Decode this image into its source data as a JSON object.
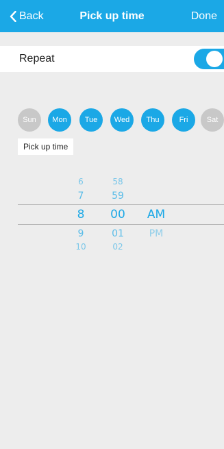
{
  "navbar": {
    "back_label": "Back",
    "title": "Pick up time",
    "done_label": "Done"
  },
  "repeat": {
    "label": "Repeat",
    "enabled": true
  },
  "days": [
    {
      "label": "Sun",
      "selected": false
    },
    {
      "label": "Mon",
      "selected": true
    },
    {
      "label": "Tue",
      "selected": true
    },
    {
      "label": "Wed",
      "selected": true
    },
    {
      "label": "Thu",
      "selected": true
    },
    {
      "label": "Fri",
      "selected": true
    },
    {
      "label": "Sat",
      "selected": false
    }
  ],
  "pickup": {
    "label": "Pick up time"
  },
  "picker": {
    "hours": [
      "6",
      "7",
      "8",
      "9",
      "10"
    ],
    "minutes": [
      "58",
      "59",
      "00",
      "01",
      "02"
    ],
    "ampm": [
      "AM",
      "PM"
    ],
    "selected": {
      "hour": "8",
      "minute": "00",
      "ampm": "AM"
    }
  },
  "colors": {
    "accent": "#1ba8e6",
    "day_off": "#c8c8c8",
    "background": "#ededed"
  }
}
